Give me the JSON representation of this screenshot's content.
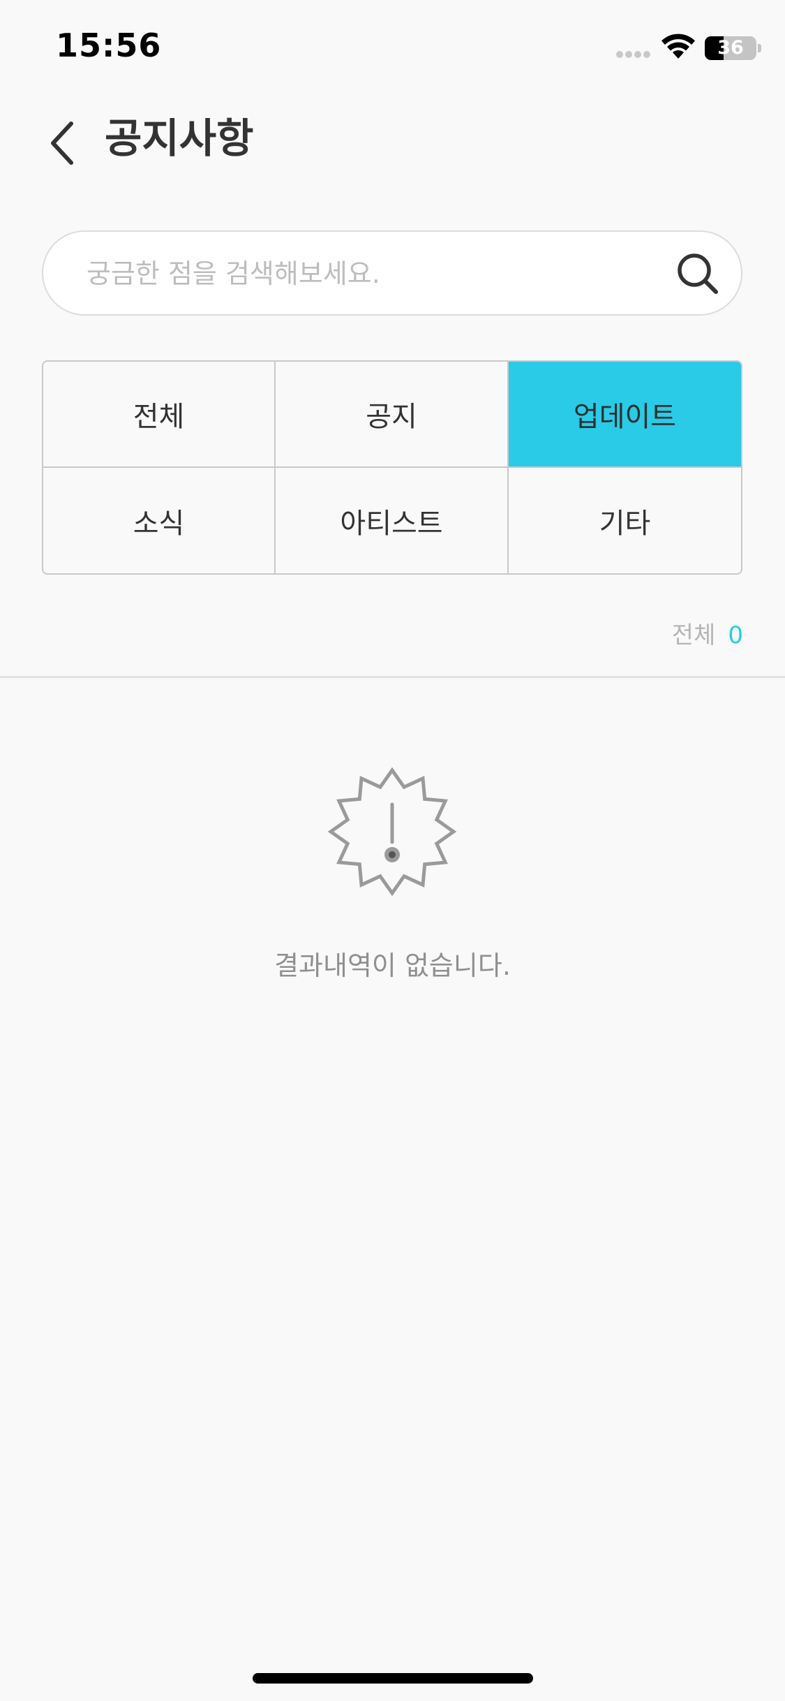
{
  "status_bar": {
    "time": "15:56",
    "battery_level": 36,
    "battery_text": "36"
  },
  "header": {
    "title": "공지사항"
  },
  "search": {
    "placeholder": "궁금한 점을 검색해보세요.",
    "value": ""
  },
  "categories": {
    "selected": "업데이트",
    "items": [
      {
        "label": "전체"
      },
      {
        "label": "공지"
      },
      {
        "label": "업데이트"
      },
      {
        "label": "소식"
      },
      {
        "label": "아티스트"
      },
      {
        "label": "기타"
      }
    ]
  },
  "results": {
    "count_label": "전체",
    "count": "0",
    "empty_message": "결과내역이 없습니다."
  },
  "colors": {
    "accent": "#29cbe6",
    "background": "#f9f9f9",
    "text": "#333333",
    "muted_text": "#8f8f8f"
  },
  "icons": [
    "chevron-left-icon",
    "search-icon",
    "alert-badge-icon",
    "wifi-icon"
  ]
}
